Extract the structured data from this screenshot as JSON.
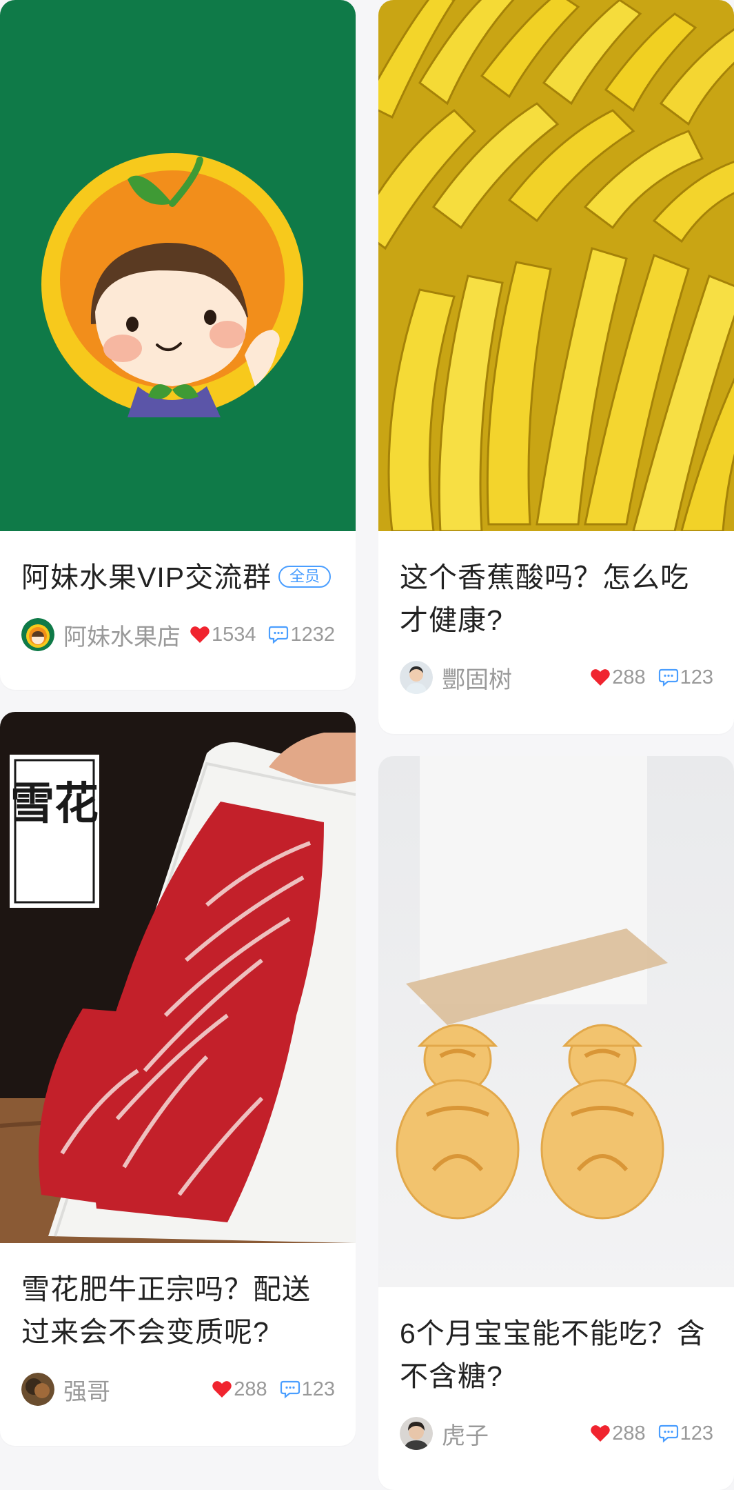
{
  "colors": {
    "background": "#f6f6f8",
    "card": "#ffffff",
    "title": "#222222",
    "meta": "#999999",
    "like": "#f0242f",
    "comment": "#4a9eff",
    "tag": "#4a9eff"
  },
  "icons": {
    "like": "heart-icon",
    "comment": "comment-bubble-icon"
  },
  "posts": [
    {
      "title": "阿妹水果VIP交流群",
      "tag": "全员",
      "author": "阿妹水果店",
      "likes": "1534",
      "comments": "1232",
      "image": "orange-girl-logo-image"
    },
    {
      "title": "这个香蕉酸吗？怎么吃才健康?",
      "author": "酆固树",
      "likes": "288",
      "comments": "123",
      "image": "bananas-image"
    },
    {
      "title": "雪花肥牛正宗吗？配送过来会不会变质呢?",
      "image_text": "雪花",
      "author": "强哥",
      "likes": "288",
      "comments": "123",
      "image": "marbled-beef-image"
    },
    {
      "title": "6个月宝宝能不能吃？含不含糖?",
      "author": "虎子",
      "likes": "288",
      "comments": "123",
      "image": "snowman-cookies-image"
    }
  ]
}
